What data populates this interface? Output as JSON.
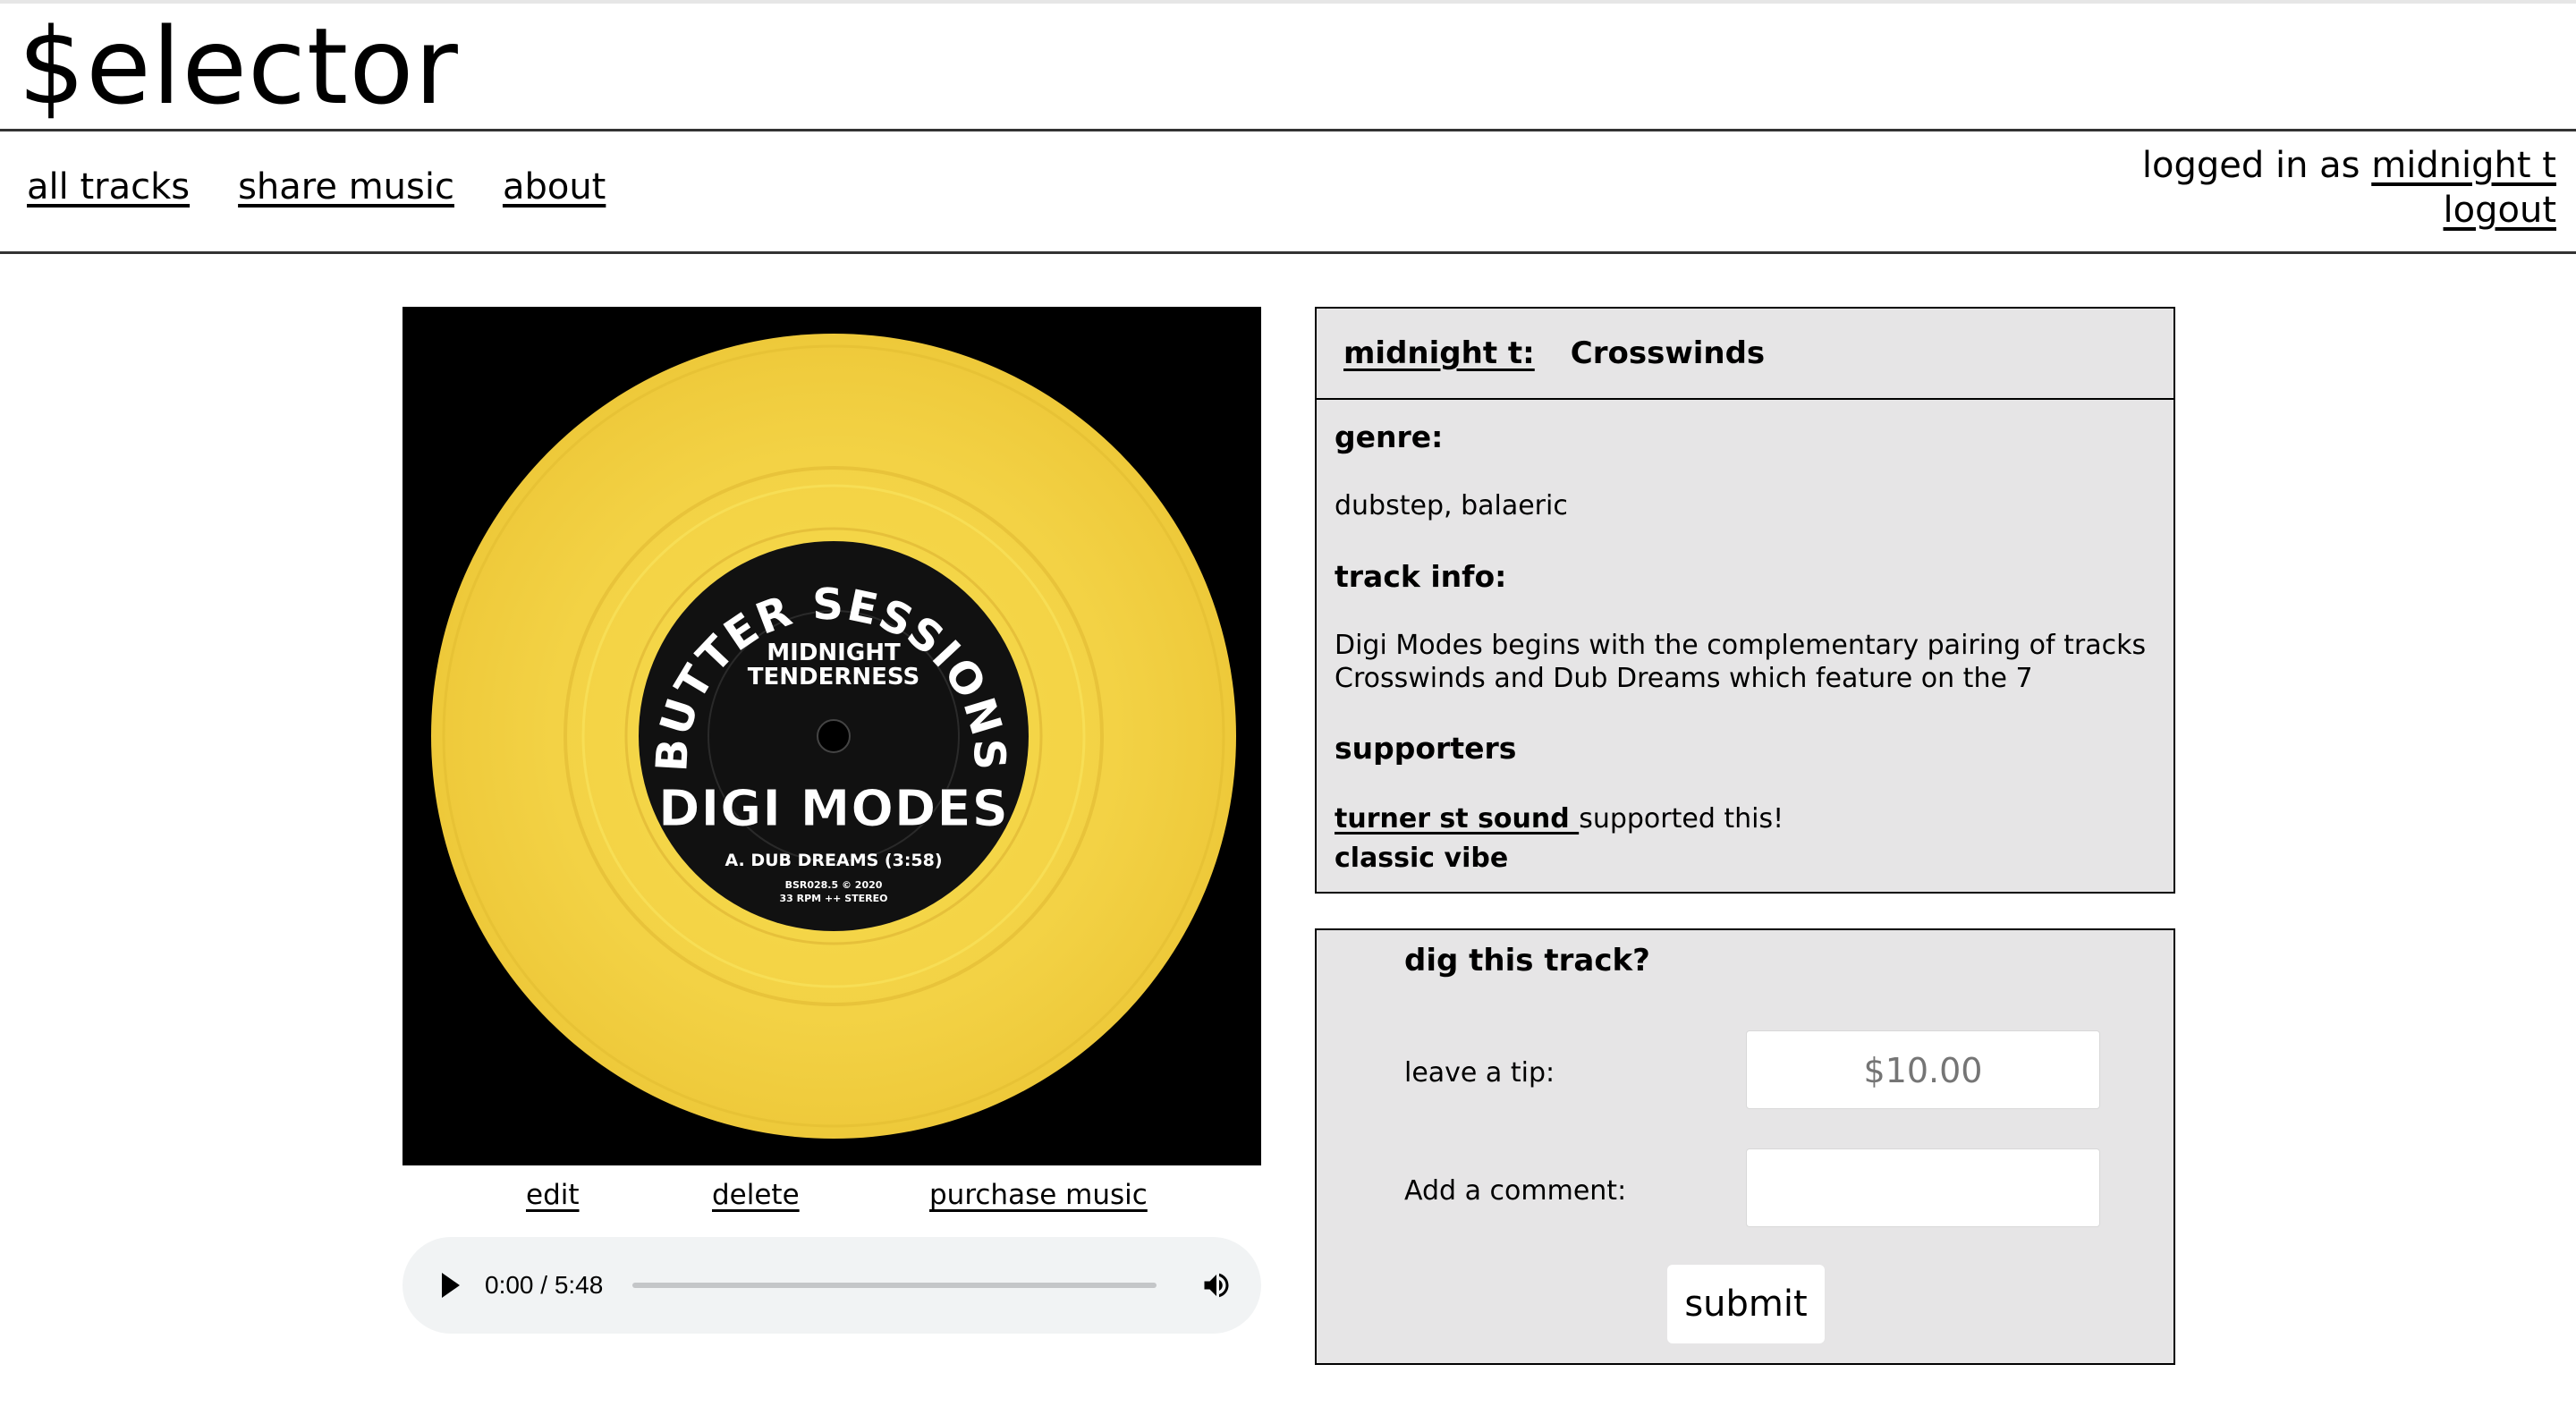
{
  "site": {
    "title": "$elector"
  },
  "nav": {
    "all_tracks": "all tracks",
    "share_music": "share music",
    "about": "about"
  },
  "account": {
    "prefix": "logged in as ",
    "username": "midnight t",
    "logout": "logout"
  },
  "artwork": {
    "label_title": "BUTTER SESSIONS",
    "label_artist_line1": "MIDNIGHT",
    "label_artist_line2": "TENDERNESS",
    "label_release": "DIGI MODES",
    "label_side": "A. DUB DREAMS (3:58)",
    "label_cat": "BSR028.5 © 2020",
    "label_info": "33 RPM ++ STEREO",
    "vinyl_color": "#f2cf3b"
  },
  "track_actions": {
    "edit": "edit",
    "delete": "delete",
    "purchase": "purchase music"
  },
  "player": {
    "time": "0:00 / 5:48",
    "progress": 0
  },
  "track": {
    "artist": "midnight t:",
    "title": "Crosswinds",
    "genre_heading": "genre:",
    "genre": "dubstep, balaeric",
    "info_heading": "track info:",
    "info_line1": "Digi Modes begins with the complementary pairing of tracks",
    "info_line2": "Crosswinds and Dub Dreams which feature on the 7",
    "supporters_heading": "supporters",
    "supporter_name": "turner st sound ",
    "supporter_suffix": "supported this!",
    "supporter_comment": "classic vibe"
  },
  "tip": {
    "heading": "dig this track?",
    "tip_label": "leave a tip:",
    "tip_placeholder": "$10.00",
    "comment_label": "Add a comment:",
    "comment_placeholder": "",
    "submit": "submit"
  }
}
